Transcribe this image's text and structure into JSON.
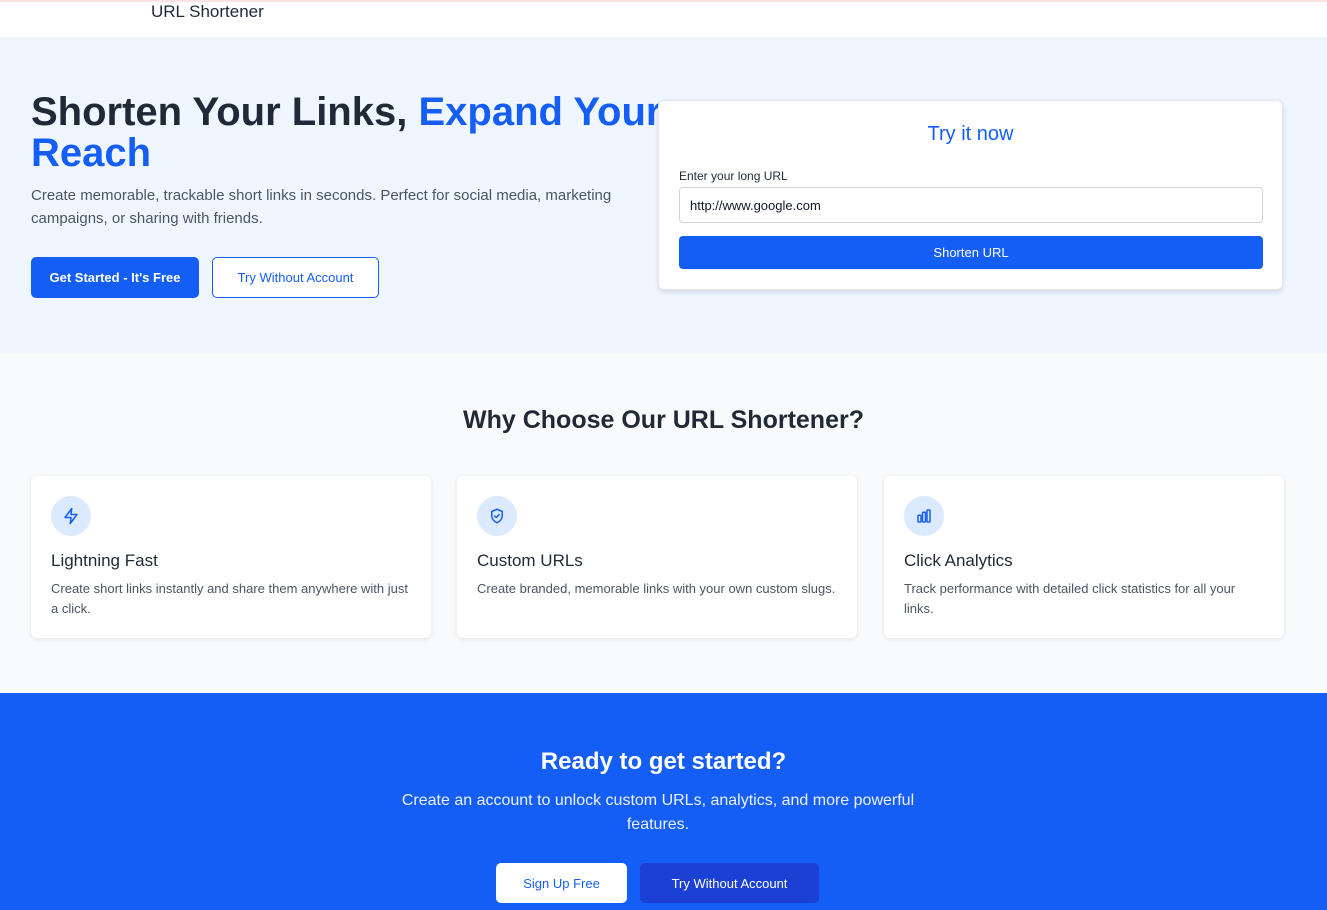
{
  "header": {
    "brand": "URL Shortener"
  },
  "hero": {
    "title_main": "Shorten Your Links, ",
    "title_accent": "Expand Your Reach",
    "subtitle": "Create memorable, trackable short links in seconds. Perfect for social media, marketing campaigns, or sharing with friends.",
    "primary_button": "Get Started - It's Free",
    "secondary_button": "Try Without Account"
  },
  "try_now": {
    "title": "Try it now",
    "label": "Enter your long URL",
    "input_value": "http://www.google.com",
    "button": "Shorten URL"
  },
  "features": {
    "title": "Why Choose Our URL Shortener?",
    "items": [
      {
        "icon": "lightning-icon",
        "title": "Lightning Fast",
        "description": "Create short links instantly and share them anywhere with just a click."
      },
      {
        "icon": "shield-check-icon",
        "title": "Custom URLs",
        "description": "Create branded, memorable links with your own custom slugs."
      },
      {
        "icon": "bar-chart-icon",
        "title": "Click Analytics",
        "description": "Track performance with detailed click statistics for all your links."
      }
    ]
  },
  "cta": {
    "title": "Ready to get started?",
    "subtitle": "Create an account to unlock custom URLs, analytics, and more powerful features.",
    "primary_button": "Sign Up Free",
    "secondary_button": "Try Without Account"
  },
  "colors": {
    "accent": "#155ef5",
    "hero_bg": "#eff6ff",
    "icon_bg": "#dbeafe",
    "text_dark": "#1f2937"
  }
}
